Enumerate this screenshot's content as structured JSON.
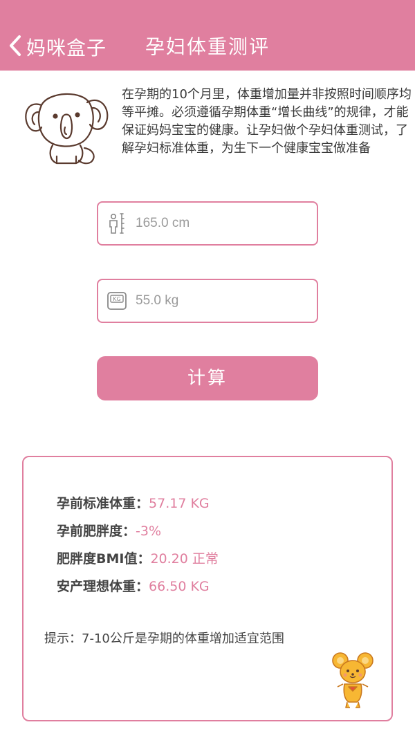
{
  "nav": {
    "back_label": "妈咪盒子",
    "title": "孕妇体重测评"
  },
  "intro": {
    "text": "在孕期的10个月里，体重增加量并非按照时间顺序均等平摊。必须遵循孕期体重“增长曲线”的规律，才能保证妈妈宝宝的健康。让孕妇做个孕妇体重测试，了解孕妇标准体重，为生下一个健康宝宝做准备"
  },
  "form": {
    "height_placeholder": "165.0 cm",
    "weight_placeholder": "55.0 kg",
    "calculate_label": "计算"
  },
  "results": {
    "standard_weight": {
      "label": "孕前标准体重：",
      "value": "57.17 KG"
    },
    "obesity": {
      "label": "孕前肥胖度：",
      "value": "-3%"
    },
    "bmi": {
      "label": "肥胖度BMI值：",
      "value": "20.20 正常"
    },
    "ideal_weight": {
      "label": "安产理想体重：",
      "value": "66.50 KG"
    },
    "tip": "提示：7-10公斤是孕期的体重增加适宜范围"
  },
  "colors": {
    "accent": "#e07f9f",
    "text": "#3a3a3a"
  },
  "icons": {
    "back": "chevron-left-icon",
    "height": "person-ruler-icon",
    "weight": "kg-scale-icon"
  }
}
